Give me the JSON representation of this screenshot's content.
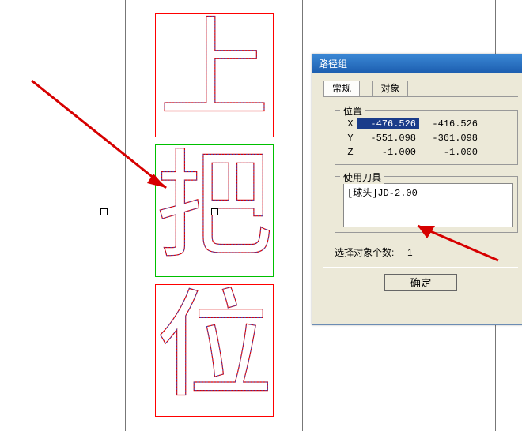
{
  "dialog": {
    "title": "路径组",
    "tabs": {
      "general": "常规",
      "object": "对象"
    },
    "position_group": {
      "label": "位置",
      "rows": [
        {
          "label": "X",
          "v1": "-476.526",
          "v2": "-416.526"
        },
        {
          "label": "Y",
          "v1": "-551.098",
          "v2": "-361.098"
        },
        {
          "label": "Z",
          "v1": "-1.000",
          "v2": "-1.000"
        }
      ]
    },
    "tool_group": {
      "label": "使用刀具",
      "item": "[球头]JD-2.00"
    },
    "count_label": "选择对象个数:",
    "count_value": "1",
    "ok": "确定"
  },
  "canvas": {
    "glyphs": [
      "上",
      "把",
      "位"
    ]
  }
}
